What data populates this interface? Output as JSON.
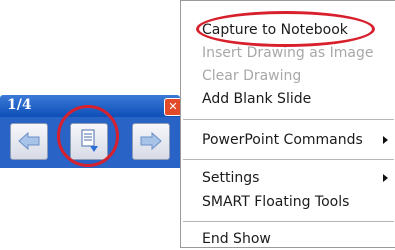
{
  "toolbar": {
    "page_indicator": "1/4",
    "buttons": [
      {
        "icon": "arrow-left-icon"
      },
      {
        "icon": "menu-document-icon"
      },
      {
        "icon": "arrow-right-icon"
      }
    ]
  },
  "menu": {
    "items": [
      {
        "label": "Capture to Notebook",
        "enabled": true
      },
      {
        "label": "Insert Drawing as Image",
        "enabled": false
      },
      {
        "label": "Clear Drawing",
        "enabled": false
      },
      {
        "label": "Add Blank Slide",
        "enabled": true
      },
      {
        "label": "PowerPoint Commands",
        "enabled": true,
        "submenu": true
      },
      {
        "label": "Settings",
        "enabled": true,
        "submenu": true
      },
      {
        "label": "SMART Floating Tools",
        "enabled": true
      },
      {
        "label": "End Show",
        "enabled": true
      }
    ]
  },
  "annotation_color": "#d8202c",
  "toolbar_color": "#2a63c6"
}
